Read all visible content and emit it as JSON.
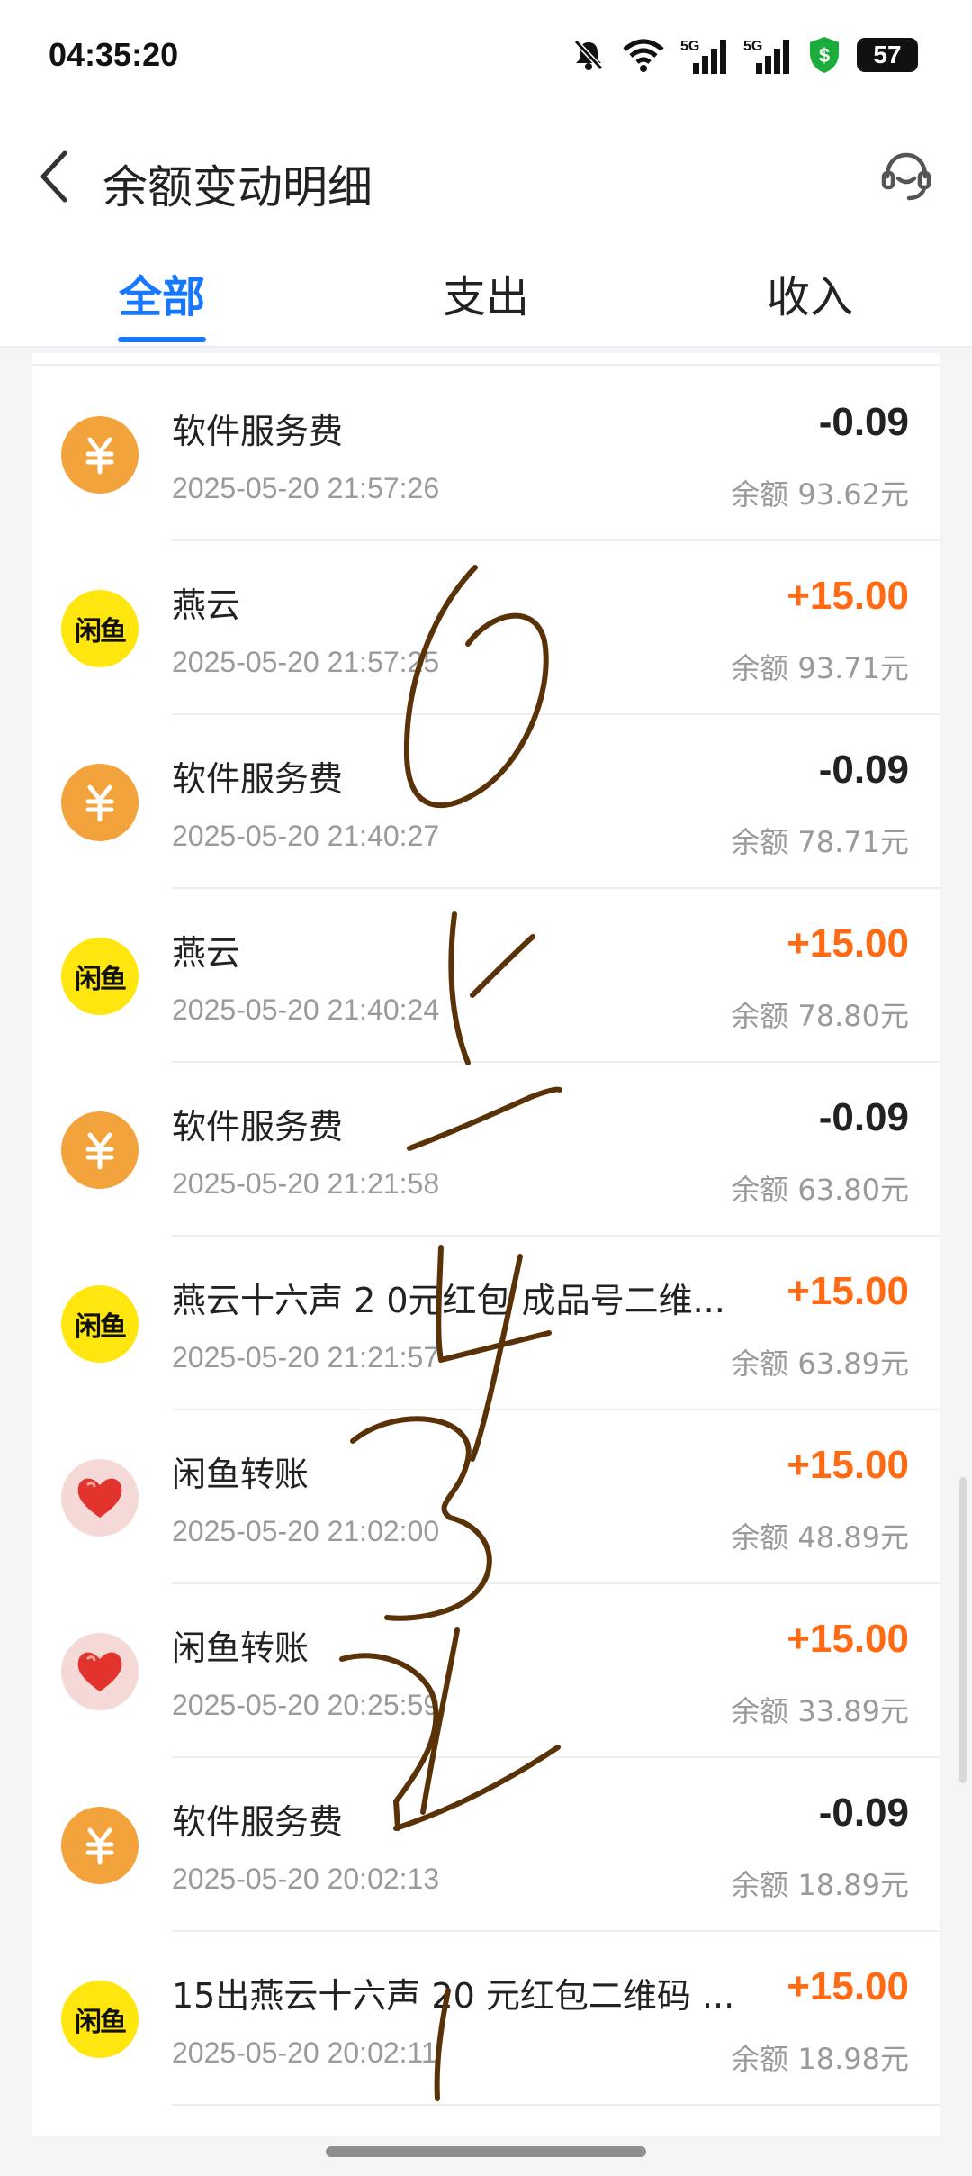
{
  "status_bar": {
    "time": "04:35:20",
    "battery": "57",
    "network_labels": [
      "5G",
      "5G"
    ]
  },
  "header": {
    "title": "余额变动明细"
  },
  "tabs": [
    {
      "label": "全部",
      "active": true
    },
    {
      "label": "支出",
      "active": false
    },
    {
      "label": "收入",
      "active": false
    }
  ],
  "transactions": [
    {
      "icon": "yuan-icon",
      "icon_glyph": "¥",
      "name": "软件服务费",
      "time": "2025-05-20 21:57:26",
      "amount": "-0.09",
      "balance": "余额 93.62元",
      "type": "expense"
    },
    {
      "icon": "xianyu-icon",
      "icon_glyph": "闲鱼",
      "name": "燕云",
      "time": "2025-05-20 21:57:25",
      "amount": "+15.00",
      "balance": "余额 93.71元",
      "type": "income"
    },
    {
      "icon": "yuan-icon",
      "icon_glyph": "¥",
      "name": "软件服务费",
      "time": "2025-05-20 21:40:27",
      "amount": "-0.09",
      "balance": "余额 78.71元",
      "type": "expense"
    },
    {
      "icon": "xianyu-icon",
      "icon_glyph": "闲鱼",
      "name": "燕云",
      "time": "2025-05-20 21:40:24",
      "amount": "+15.00",
      "balance": "余额 78.80元",
      "type": "income"
    },
    {
      "icon": "yuan-icon",
      "icon_glyph": "¥",
      "name": "软件服务费",
      "time": "2025-05-20 21:21:58",
      "amount": "-0.09",
      "balance": "余额 63.80元",
      "type": "expense"
    },
    {
      "icon": "xianyu-icon",
      "icon_glyph": "闲鱼",
      "name": "燕云十六声 2 0元红包 成品号二维...",
      "time": "2025-05-20 21:21:57",
      "amount": "+15.00",
      "balance": "余额 63.89元",
      "type": "income"
    },
    {
      "icon": "heart-avatar-icon",
      "icon_glyph": "",
      "name": "闲鱼转账",
      "time": "2025-05-20 21:02:00",
      "amount": "+15.00",
      "balance": "余额 48.89元",
      "type": "income"
    },
    {
      "icon": "heart-avatar-icon",
      "icon_glyph": "",
      "name": "闲鱼转账",
      "time": "2025-05-20 20:25:59",
      "amount": "+15.00",
      "balance": "余额 33.89元",
      "type": "income"
    },
    {
      "icon": "yuan-icon",
      "icon_glyph": "¥",
      "name": "软件服务费",
      "time": "2025-05-20 20:02:13",
      "amount": "-0.09",
      "balance": "余额 18.89元",
      "type": "expense"
    },
    {
      "icon": "xianyu-icon",
      "icon_glyph": "闲鱼",
      "name": "15出燕云十六声 20 元红包二维码 ...",
      "time": "2025-05-20 20:02:11",
      "amount": "+15.00",
      "balance": "余额 18.98元",
      "type": "income"
    }
  ],
  "colors": {
    "accent": "#1677ff",
    "income": "#ff6a13",
    "expense": "#222222",
    "scribble": "#5a3208"
  }
}
